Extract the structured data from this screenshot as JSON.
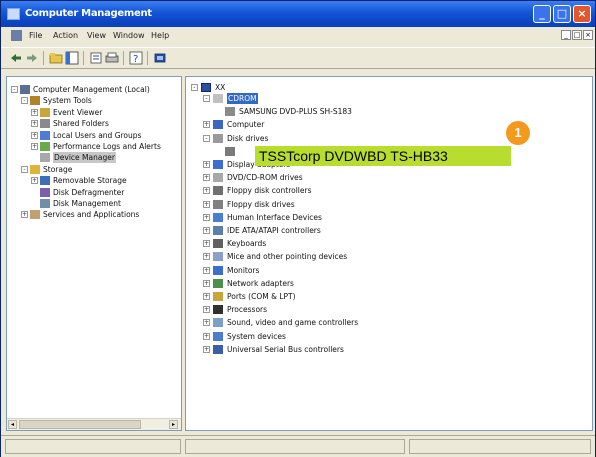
{
  "window": {
    "title": "Computer Management",
    "controls": {
      "minimize": "_",
      "maximize": "□",
      "close": "×"
    }
  },
  "menubar": {
    "items": [
      "File",
      "Action",
      "View",
      "Window",
      "Help"
    ],
    "mdi_controls": [
      "_",
      "□",
      "×"
    ]
  },
  "toolbar": {
    "icons": [
      "back-arrow-icon",
      "forward-arrow-icon",
      "up-folder-icon",
      "show-tree-icon",
      "properties-icon",
      "print-icon",
      "help-icon",
      "scan-hardware-icon"
    ]
  },
  "left_tree": {
    "items": [
      {
        "label": "Computer Management (Local)",
        "level": 0,
        "expander": "-"
      },
      {
        "label": "System Tools",
        "level": 1,
        "expander": "-"
      },
      {
        "label": "Event Viewer",
        "level": 2,
        "expander": "+"
      },
      {
        "label": "Shared Folders",
        "level": 2,
        "expander": "+"
      },
      {
        "label": "Local Users and Groups",
        "level": 2,
        "expander": "+"
      },
      {
        "label": "Performance Logs and Alerts",
        "level": 2,
        "expander": "+"
      },
      {
        "label": "Device Manager",
        "level": 2,
        "expander": "",
        "selected": true
      },
      {
        "label": "Storage",
        "level": 1,
        "expander": "-"
      },
      {
        "label": "Removable Storage",
        "level": 2,
        "expander": "+"
      },
      {
        "label": "Disk Defragmenter",
        "level": 2,
        "expander": ""
      },
      {
        "label": "Disk Management",
        "level": 2,
        "expander": ""
      },
      {
        "label": "Services and Applications",
        "level": 1,
        "expander": "+"
      }
    ]
  },
  "right_tree": {
    "root": "XX",
    "items": [
      {
        "label": "CDROM",
        "level": 1,
        "expander": "-",
        "selected": true
      },
      {
        "label": "SAMSUNG DVD-PLUS SH-S183",
        "level": 2,
        "expander": ""
      },
      {
        "label": "Computer",
        "level": 1,
        "expander": "+"
      },
      {
        "label": "Disk drives",
        "level": 1,
        "expander": "-"
      },
      {
        "label": "",
        "level": 2,
        "expander": ""
      },
      {
        "label": "Display adapters",
        "level": 1,
        "expander": "+"
      },
      {
        "label": "DVD/CD-ROM drives",
        "level": 1,
        "expander": "+"
      },
      {
        "label": "Floppy disk controllers",
        "level": 1,
        "expander": "+"
      },
      {
        "label": "Floppy disk drives",
        "level": 1,
        "expander": "+"
      },
      {
        "label": "Human Interface Devices",
        "level": 1,
        "expander": "+"
      },
      {
        "label": "IDE ATA/ATAPI controllers",
        "level": 1,
        "expander": "+"
      },
      {
        "label": "Keyboards",
        "level": 1,
        "expander": "+"
      },
      {
        "label": "Mice and other pointing devices",
        "level": 1,
        "expander": "+"
      },
      {
        "label": "Monitors",
        "level": 1,
        "expander": "+"
      },
      {
        "label": "Network adapters",
        "level": 1,
        "expander": "+"
      },
      {
        "label": "Ports (COM & LPT)",
        "level": 1,
        "expander": "+"
      },
      {
        "label": "Processors",
        "level": 1,
        "expander": "+"
      },
      {
        "label": "Sound, video and game controllers",
        "level": 1,
        "expander": "+"
      },
      {
        "label": "System devices",
        "level": 1,
        "expander": "+"
      },
      {
        "label": "Universal Serial Bus controllers",
        "level": 1,
        "expander": "+"
      }
    ]
  },
  "callout": {
    "number": "1",
    "text": "TSSTcorp DVDWBD TS-HB33",
    "label_color": "#b8dd2e",
    "badge_color": "#f39a1d"
  },
  "scrollbar": {
    "left_arrow": "◂",
    "right_arrow": "▸"
  },
  "colors": {
    "title_blue": "#1658d8",
    "selection_blue": "#316ac5",
    "close_red": "#e4572d"
  }
}
